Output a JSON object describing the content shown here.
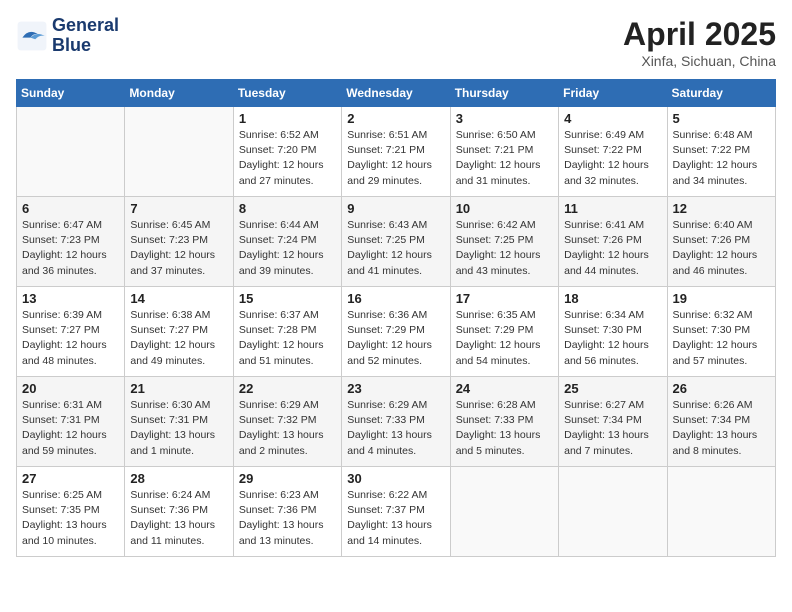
{
  "header": {
    "logo_line1": "General",
    "logo_line2": "Blue",
    "month": "April 2025",
    "location": "Xinfa, Sichuan, China"
  },
  "days_of_week": [
    "Sunday",
    "Monday",
    "Tuesday",
    "Wednesday",
    "Thursday",
    "Friday",
    "Saturday"
  ],
  "weeks": [
    [
      {
        "day": "",
        "info": ""
      },
      {
        "day": "",
        "info": ""
      },
      {
        "day": "1",
        "info": "Sunrise: 6:52 AM\nSunset: 7:20 PM\nDaylight: 12 hours and 27 minutes."
      },
      {
        "day": "2",
        "info": "Sunrise: 6:51 AM\nSunset: 7:21 PM\nDaylight: 12 hours and 29 minutes."
      },
      {
        "day": "3",
        "info": "Sunrise: 6:50 AM\nSunset: 7:21 PM\nDaylight: 12 hours and 31 minutes."
      },
      {
        "day": "4",
        "info": "Sunrise: 6:49 AM\nSunset: 7:22 PM\nDaylight: 12 hours and 32 minutes."
      },
      {
        "day": "5",
        "info": "Sunrise: 6:48 AM\nSunset: 7:22 PM\nDaylight: 12 hours and 34 minutes."
      }
    ],
    [
      {
        "day": "6",
        "info": "Sunrise: 6:47 AM\nSunset: 7:23 PM\nDaylight: 12 hours and 36 minutes."
      },
      {
        "day": "7",
        "info": "Sunrise: 6:45 AM\nSunset: 7:23 PM\nDaylight: 12 hours and 37 minutes."
      },
      {
        "day": "8",
        "info": "Sunrise: 6:44 AM\nSunset: 7:24 PM\nDaylight: 12 hours and 39 minutes."
      },
      {
        "day": "9",
        "info": "Sunrise: 6:43 AM\nSunset: 7:25 PM\nDaylight: 12 hours and 41 minutes."
      },
      {
        "day": "10",
        "info": "Sunrise: 6:42 AM\nSunset: 7:25 PM\nDaylight: 12 hours and 43 minutes."
      },
      {
        "day": "11",
        "info": "Sunrise: 6:41 AM\nSunset: 7:26 PM\nDaylight: 12 hours and 44 minutes."
      },
      {
        "day": "12",
        "info": "Sunrise: 6:40 AM\nSunset: 7:26 PM\nDaylight: 12 hours and 46 minutes."
      }
    ],
    [
      {
        "day": "13",
        "info": "Sunrise: 6:39 AM\nSunset: 7:27 PM\nDaylight: 12 hours and 48 minutes."
      },
      {
        "day": "14",
        "info": "Sunrise: 6:38 AM\nSunset: 7:27 PM\nDaylight: 12 hours and 49 minutes."
      },
      {
        "day": "15",
        "info": "Sunrise: 6:37 AM\nSunset: 7:28 PM\nDaylight: 12 hours and 51 minutes."
      },
      {
        "day": "16",
        "info": "Sunrise: 6:36 AM\nSunset: 7:29 PM\nDaylight: 12 hours and 52 minutes."
      },
      {
        "day": "17",
        "info": "Sunrise: 6:35 AM\nSunset: 7:29 PM\nDaylight: 12 hours and 54 minutes."
      },
      {
        "day": "18",
        "info": "Sunrise: 6:34 AM\nSunset: 7:30 PM\nDaylight: 12 hours and 56 minutes."
      },
      {
        "day": "19",
        "info": "Sunrise: 6:32 AM\nSunset: 7:30 PM\nDaylight: 12 hours and 57 minutes."
      }
    ],
    [
      {
        "day": "20",
        "info": "Sunrise: 6:31 AM\nSunset: 7:31 PM\nDaylight: 12 hours and 59 minutes."
      },
      {
        "day": "21",
        "info": "Sunrise: 6:30 AM\nSunset: 7:31 PM\nDaylight: 13 hours and 1 minute."
      },
      {
        "day": "22",
        "info": "Sunrise: 6:29 AM\nSunset: 7:32 PM\nDaylight: 13 hours and 2 minutes."
      },
      {
        "day": "23",
        "info": "Sunrise: 6:29 AM\nSunset: 7:33 PM\nDaylight: 13 hours and 4 minutes."
      },
      {
        "day": "24",
        "info": "Sunrise: 6:28 AM\nSunset: 7:33 PM\nDaylight: 13 hours and 5 minutes."
      },
      {
        "day": "25",
        "info": "Sunrise: 6:27 AM\nSunset: 7:34 PM\nDaylight: 13 hours and 7 minutes."
      },
      {
        "day": "26",
        "info": "Sunrise: 6:26 AM\nSunset: 7:34 PM\nDaylight: 13 hours and 8 minutes."
      }
    ],
    [
      {
        "day": "27",
        "info": "Sunrise: 6:25 AM\nSunset: 7:35 PM\nDaylight: 13 hours and 10 minutes."
      },
      {
        "day": "28",
        "info": "Sunrise: 6:24 AM\nSunset: 7:36 PM\nDaylight: 13 hours and 11 minutes."
      },
      {
        "day": "29",
        "info": "Sunrise: 6:23 AM\nSunset: 7:36 PM\nDaylight: 13 hours and 13 minutes."
      },
      {
        "day": "30",
        "info": "Sunrise: 6:22 AM\nSunset: 7:37 PM\nDaylight: 13 hours and 14 minutes."
      },
      {
        "day": "",
        "info": ""
      },
      {
        "day": "",
        "info": ""
      },
      {
        "day": "",
        "info": ""
      }
    ]
  ]
}
